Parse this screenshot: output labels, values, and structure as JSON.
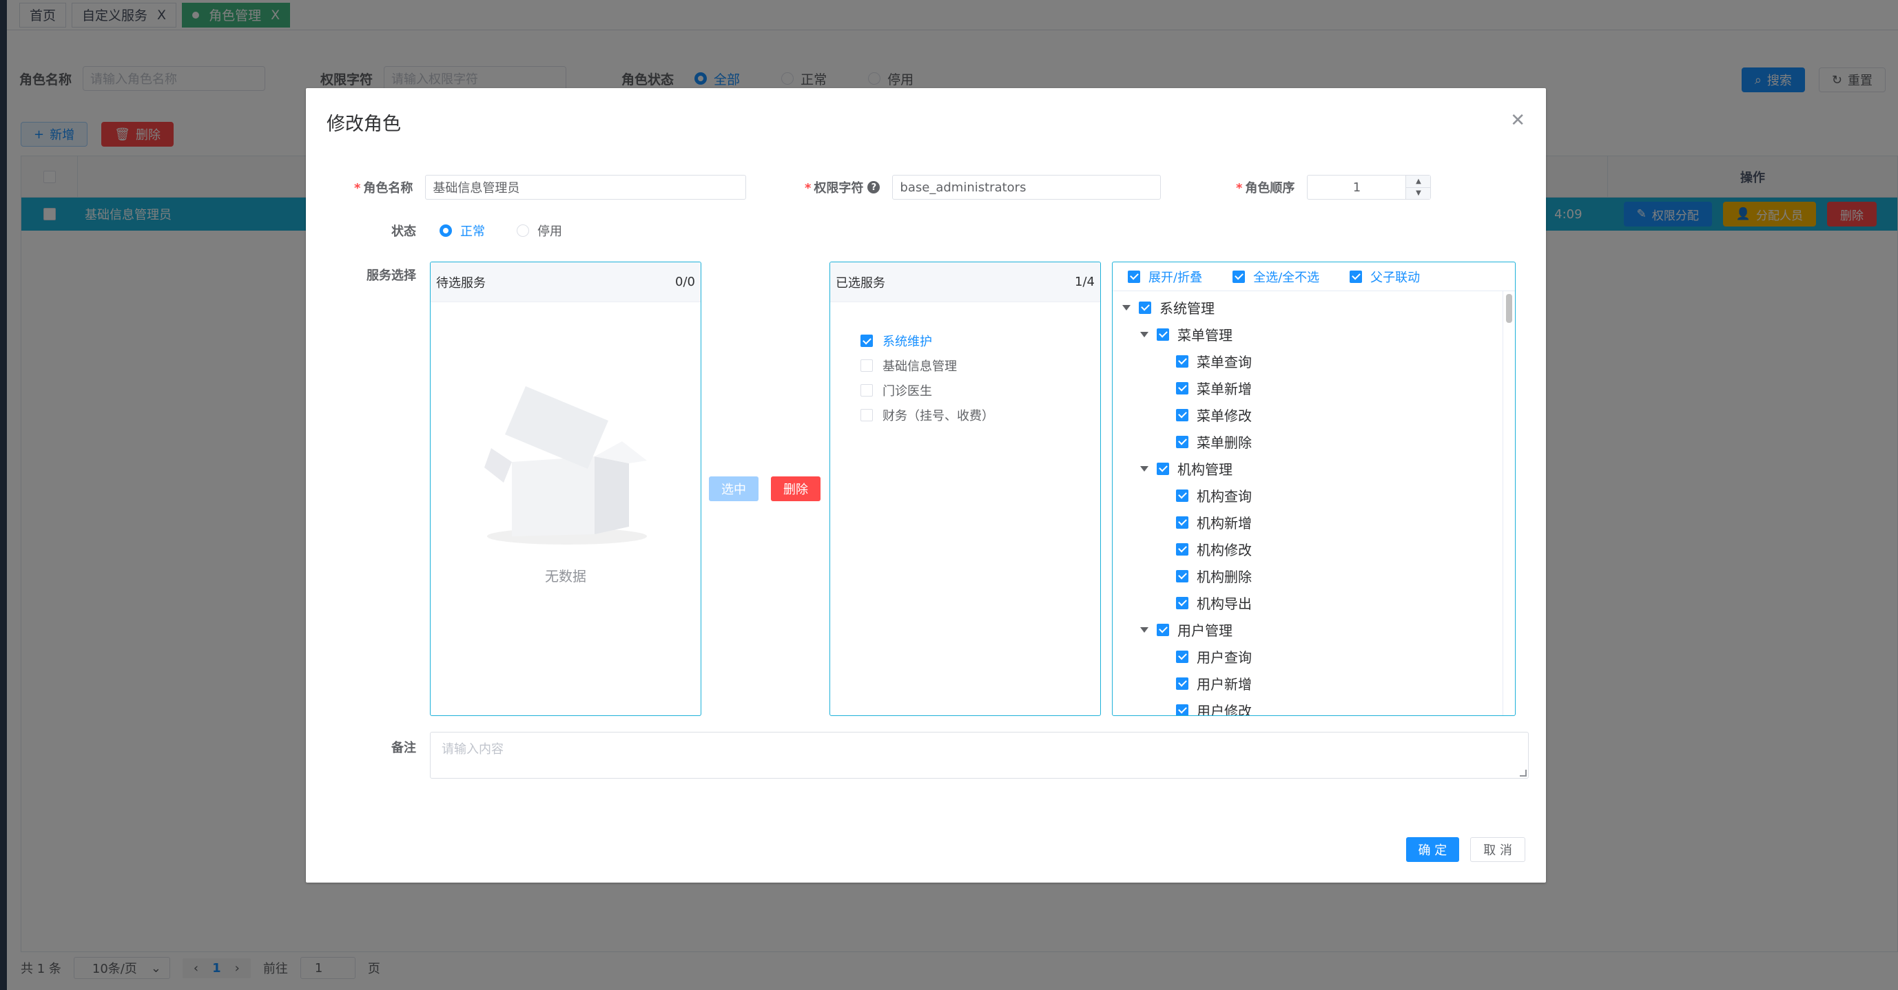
{
  "tabs": [
    {
      "label": "首页",
      "closable": false,
      "active": false
    },
    {
      "label": "自定义服务",
      "closable": true,
      "active": false
    },
    {
      "label": "角色管理",
      "closable": true,
      "active": true
    }
  ],
  "tab_close_glyph": "X",
  "search": {
    "role_name_label": "角色名称",
    "role_name_placeholder": "请输入角色名称",
    "role_key_label": "权限字符",
    "role_key_placeholder": "请输入权限字符",
    "status_label": "角色状态",
    "status_options": [
      "全部",
      "正常",
      "停用"
    ],
    "search_btn": "搜索",
    "reset_btn": "重置"
  },
  "toolbar": {
    "add_btn": "新增",
    "delete_btn": "删除"
  },
  "table": {
    "op_header": "操作",
    "rows": [
      {
        "name": "基础信息管理员",
        "time": "4:09",
        "op_perm": "权限分配",
        "op_assign": "分配人员",
        "op_delete": "删除"
      }
    ]
  },
  "pager": {
    "total": "共 1 条",
    "page_size": "10条/页",
    "current": "1",
    "goto": "前往",
    "goto_value": "1",
    "page_suffix": "页"
  },
  "dialog": {
    "title": "修改角色",
    "role_name_label": "角色名称",
    "role_name_value": "基础信息管理员",
    "role_key_label": "权限字符",
    "role_key_value": "base_administrators",
    "order_label": "角色顺序",
    "order_value": "1",
    "status_label": "状态",
    "status_normal": "正常",
    "status_disabled": "停用",
    "service_label": "服务选择",
    "left_panel_title": "待选服务",
    "left_panel_count": "0/0",
    "empty_text": "无数据",
    "select_btn": "选中",
    "remove_btn": "删除",
    "right_panel_title": "已选服务",
    "right_panel_count": "1/4",
    "services": [
      {
        "label": "系统维护",
        "checked": true
      },
      {
        "label": "基础信息管理",
        "checked": false
      },
      {
        "label": "门诊医生",
        "checked": false
      },
      {
        "label": "财务（挂号、收费）",
        "checked": false
      }
    ],
    "tree_options": [
      "展开/折叠",
      "全选/全不选",
      "父子联动"
    ],
    "tree": [
      {
        "label": "系统管理",
        "level": 0,
        "expanded": true
      },
      {
        "label": "菜单管理",
        "level": 1,
        "expanded": true
      },
      {
        "label": "菜单查询",
        "level": 2
      },
      {
        "label": "菜单新增",
        "level": 2
      },
      {
        "label": "菜单修改",
        "level": 2
      },
      {
        "label": "菜单删除",
        "level": 2
      },
      {
        "label": "机构管理",
        "level": 1,
        "expanded": true
      },
      {
        "label": "机构查询",
        "level": 2
      },
      {
        "label": "机构新增",
        "level": 2
      },
      {
        "label": "机构修改",
        "level": 2
      },
      {
        "label": "机构删除",
        "level": 2
      },
      {
        "label": "机构导出",
        "level": 2
      },
      {
        "label": "用户管理",
        "level": 1,
        "expanded": true
      },
      {
        "label": "用户查询",
        "level": 2
      },
      {
        "label": "用户新增",
        "level": 2
      },
      {
        "label": "用户修改",
        "level": 2
      }
    ],
    "remark_label": "备注",
    "remark_placeholder": "请输入内容",
    "confirm_btn": "确 定",
    "cancel_btn": "取 消"
  },
  "colors": {
    "primary": "#1890ff",
    "danger": "#ff4949",
    "warning": "#ffba00",
    "row_highlight": "#1db1d9",
    "tab_active": "#42b983"
  }
}
